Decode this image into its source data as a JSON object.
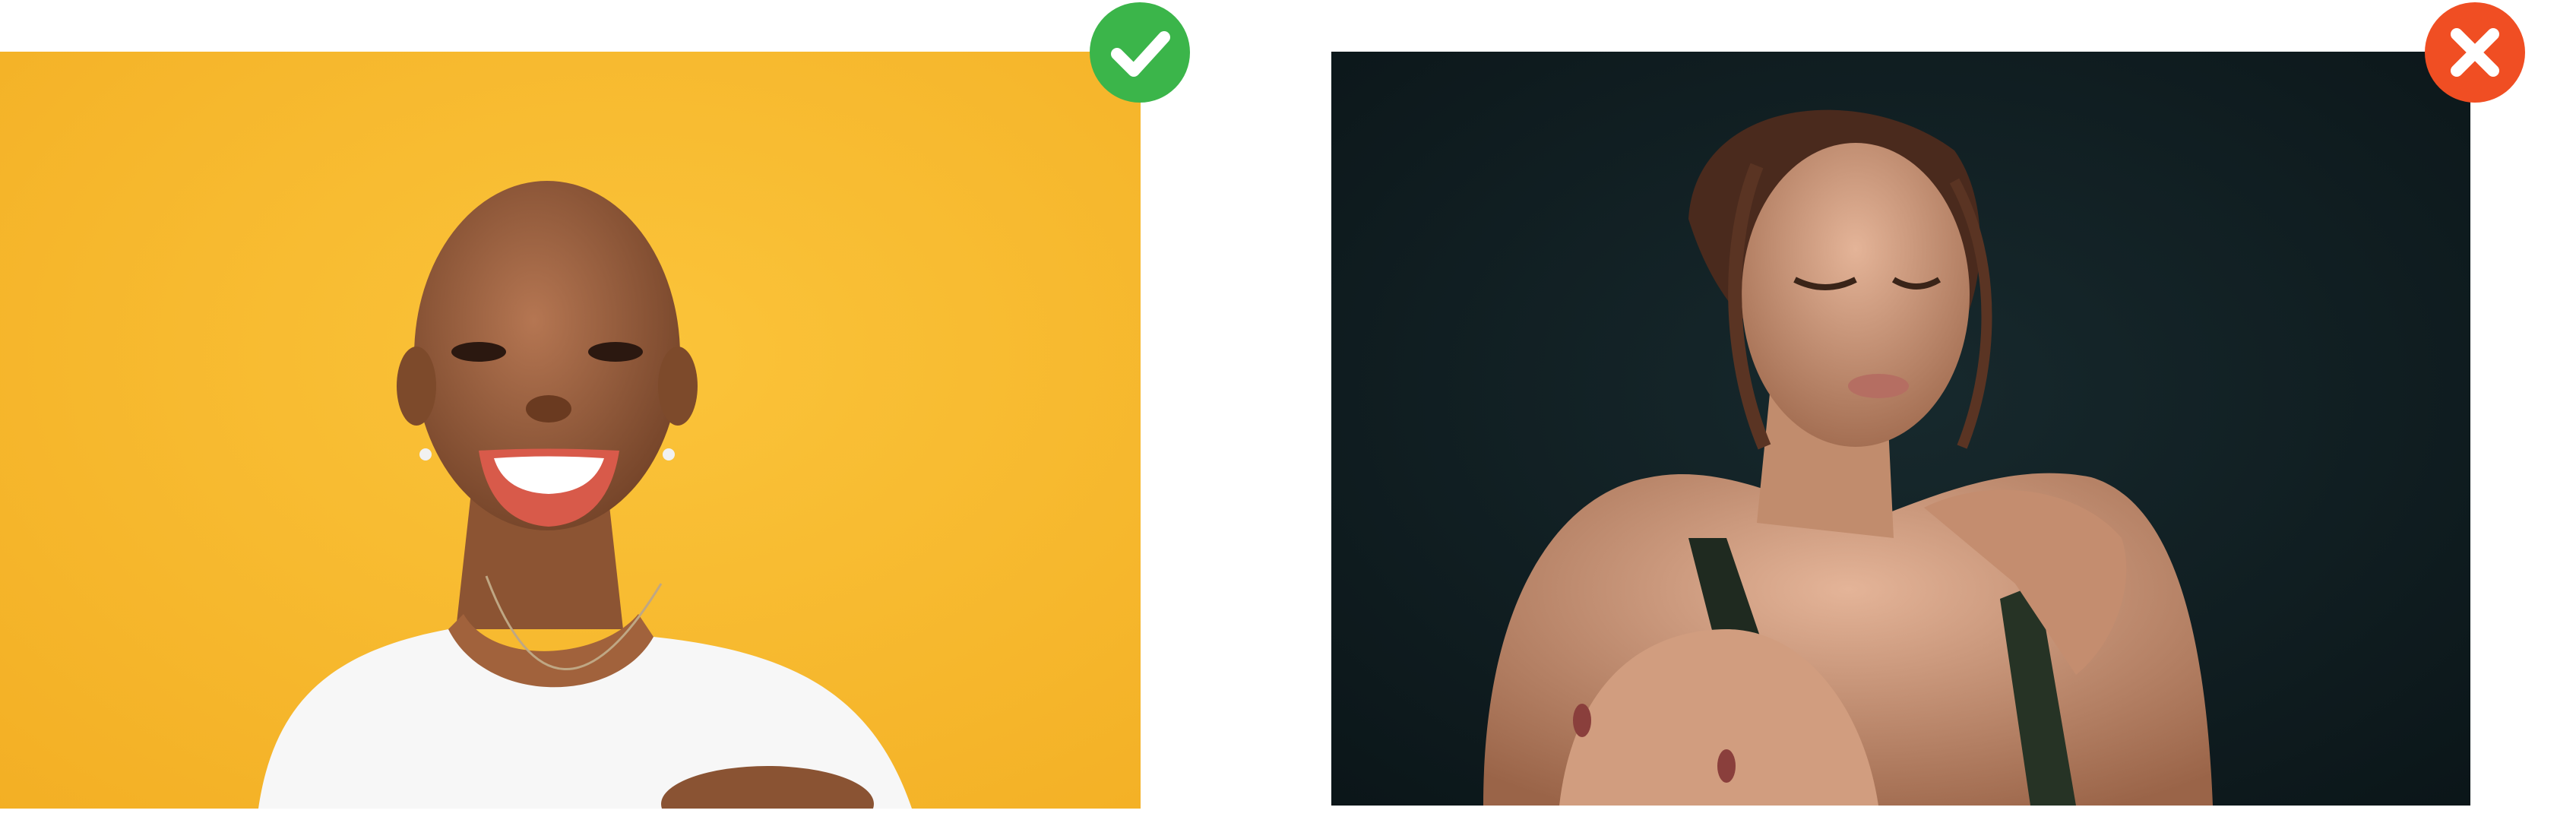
{
  "examples": [
    {
      "verdict": "correct",
      "badge_icon": "check-icon",
      "badge_color": "#3bb54a",
      "photo": {
        "subject": "smiling-woman-portrait",
        "background_color": "#f7b82c",
        "shirt_color": "#ffffff"
      }
    },
    {
      "verdict": "incorrect",
      "badge_icon": "close-icon",
      "badge_color": "#f04e23",
      "photo": {
        "subject": "woman-dark-studio-portrait",
        "background_color": "#0d1c20",
        "skin_color": "#c98f6e"
      }
    }
  ]
}
